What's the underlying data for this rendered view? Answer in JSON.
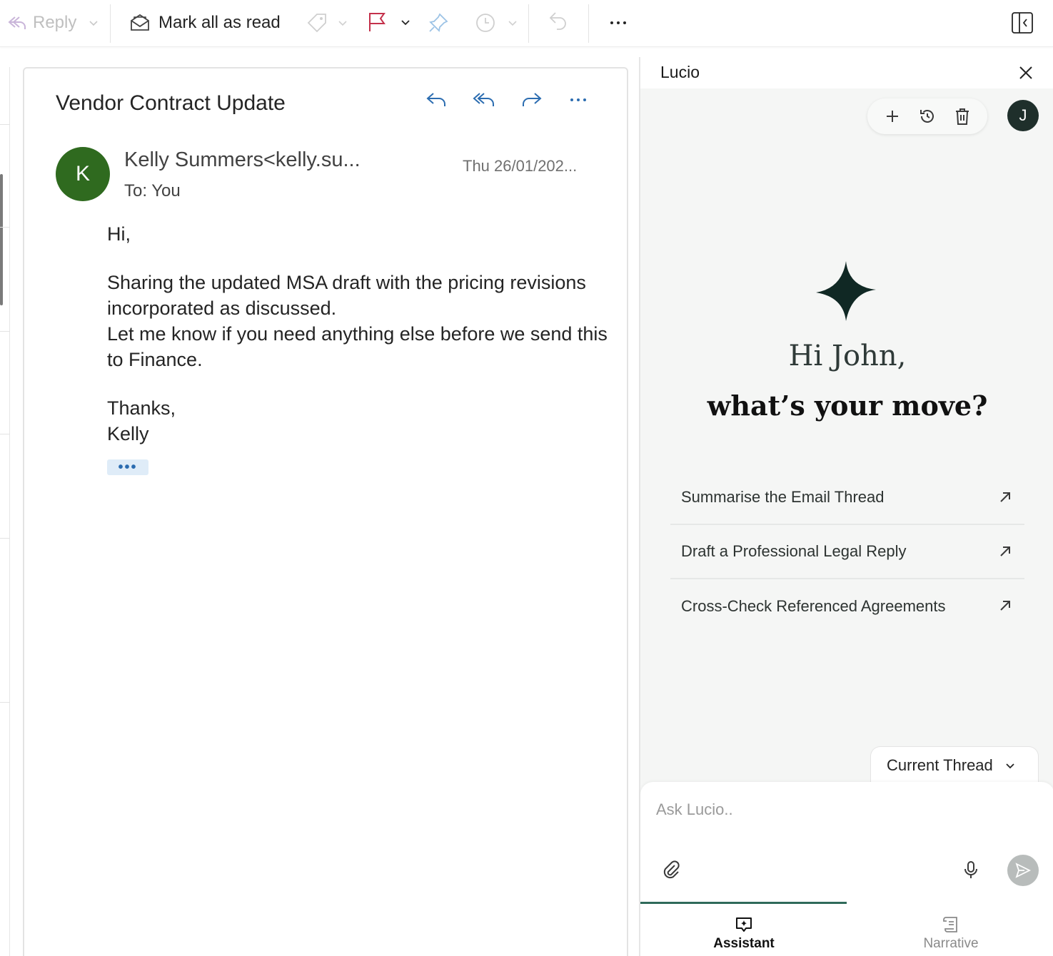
{
  "toolbar": {
    "reply_label": "Reply",
    "mark_all_read_label": "Mark all as read"
  },
  "mail": {
    "subject": "Vendor Contract Update",
    "sender_initial": "K",
    "sender": "Kelly Summers<kelly.su...",
    "to": "To:  You",
    "date": "Thu 26/01/202...",
    "body": {
      "greeting": "Hi,",
      "paragraph1": "Sharing the updated MSA draft with the pricing revisions incorporated as discussed.",
      "paragraph2": "Let me know if you need anything else before we send this to Finance.",
      "signoff": "Thanks,",
      "signature": "Kelly"
    },
    "show_more": "•••"
  },
  "panel": {
    "title": "Lucio",
    "user_initial": "J",
    "greeting_line1": "Hi John,",
    "greeting_line2": "what’s your move?",
    "suggestions": [
      {
        "label": "Summarise the Email Thread"
      },
      {
        "label": "Draft a Professional Legal Reply"
      },
      {
        "label": "Cross-Check Referenced Agreements"
      }
    ],
    "scope_label": "Current Thread",
    "input_placeholder": "Ask Lucio..",
    "tabs": {
      "assistant": "Assistant",
      "narrative": "Narrative"
    }
  },
  "colors": {
    "sender_avatar": "#2f6a1f",
    "user_avatar": "#1f2f2b",
    "flag": "#c4314b",
    "accent_blue": "#2b6cb0",
    "active_tab_underline": "#2f6a5a"
  }
}
